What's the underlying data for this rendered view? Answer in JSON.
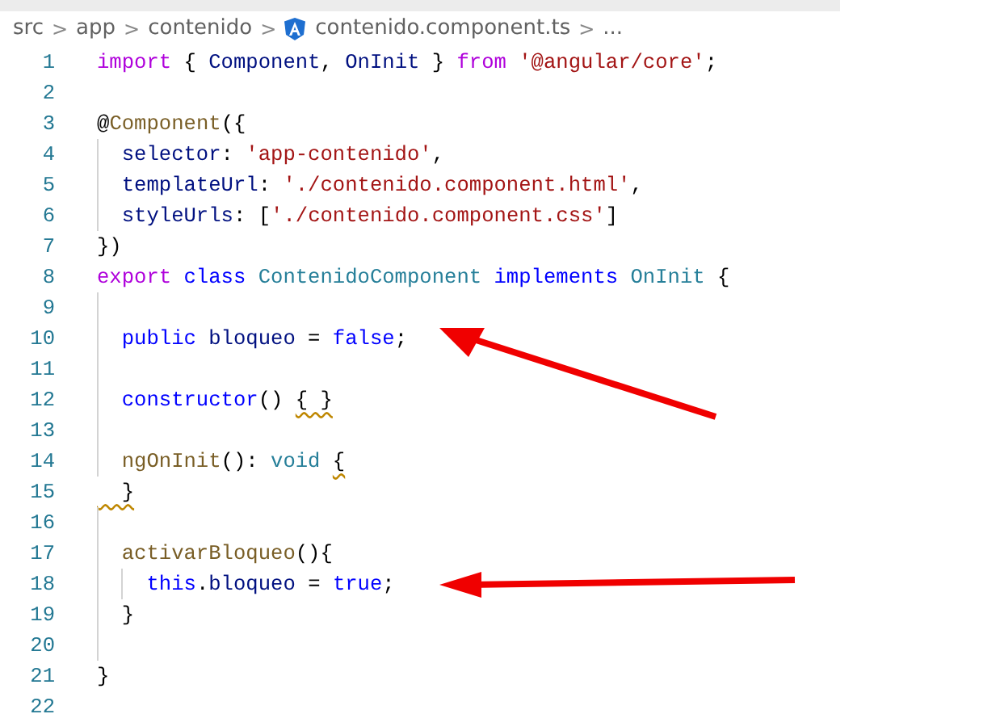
{
  "breadcrumb": [
    {
      "label": "src",
      "kind": "folder"
    },
    {
      "label": ">",
      "kind": "separator"
    },
    {
      "label": "app",
      "kind": "folder"
    },
    {
      "label": ">",
      "kind": "separator"
    },
    {
      "label": "contenido",
      "kind": "folder"
    },
    {
      "label": ">",
      "kind": "separator"
    },
    {
      "label": "contenido.component.ts",
      "kind": "file"
    },
    {
      "label": ">",
      "kind": "separator"
    },
    {
      "label": "...",
      "kind": "more"
    }
  ],
  "lines": [
    {
      "number": "1",
      "tokens": [
        {
          "t": "import",
          "kind": "kw"
        },
        {
          "t": " { ",
          "kind": "p"
        },
        {
          "t": "Component",
          "kind": "var"
        },
        {
          "t": ", ",
          "kind": "p"
        },
        {
          "t": "OnInit",
          "kind": "var"
        },
        {
          "t": " } ",
          "kind": "p"
        },
        {
          "t": "from",
          "kind": "kw"
        },
        {
          "t": " '@angular/core'",
          "kind": "str"
        },
        {
          "t": ";",
          "kind": "p"
        }
      ]
    },
    {
      "number": "2"
    },
    {
      "number": "3",
      "tokens": [
        {
          "t": "@",
          "kind": "p"
        },
        {
          "t": "Component",
          "kind": "fn"
        },
        {
          "t": "({",
          "kind": "p"
        }
      ]
    },
    {
      "number": "4",
      "indent_guide": true,
      "tokens": [
        {
          "t": "  selector",
          "kind": "var"
        },
        {
          "t": ": ",
          "kind": "p"
        },
        {
          "t": "'app-contenido'",
          "kind": "str"
        },
        {
          "t": ",",
          "kind": "p"
        }
      ]
    },
    {
      "number": "5",
      "indent_guide": true,
      "tokens": [
        {
          "t": "  templateUrl",
          "kind": "var"
        },
        {
          "t": ": ",
          "kind": "p"
        },
        {
          "t": "'./contenido.component.html'",
          "kind": "str"
        },
        {
          "t": ",",
          "kind": "p"
        }
      ]
    },
    {
      "number": "6",
      "indent_guide": true,
      "tokens": [
        {
          "t": "  styleUrls",
          "kind": "var"
        },
        {
          "t": ": [",
          "kind": "p"
        },
        {
          "t": "'./contenido.component.css'",
          "kind": "str"
        },
        {
          "t": "]",
          "kind": "p"
        }
      ]
    },
    {
      "number": "7",
      "tokens": [
        {
          "t": "})",
          "kind": "p"
        }
      ]
    },
    {
      "number": "8",
      "tokens": [
        {
          "t": "export",
          "kind": "kw"
        },
        {
          "t": " class",
          "kind": "st"
        },
        {
          "t": " ContenidoComponent",
          "kind": "type"
        },
        {
          "t": " implements",
          "kind": "st"
        },
        {
          "t": " OnInit",
          "kind": "type"
        },
        {
          "t": " {",
          "kind": "p"
        }
      ]
    },
    {
      "number": "9",
      "indent_guide": true
    },
    {
      "number": "10",
      "indent_guide": true,
      "arrow": true,
      "tokens": [
        {
          "t": "  public",
          "kind": "st"
        },
        {
          "t": " bloqueo",
          "kind": "var"
        },
        {
          "t": " = ",
          "kind": "p"
        },
        {
          "t": "false",
          "kind": "st"
        },
        {
          "t": ";",
          "kind": "p"
        }
      ]
    },
    {
      "number": "11",
      "indent_guide": true
    },
    {
      "number": "12",
      "indent_guide": true,
      "tokens": [
        {
          "t": "  constructor",
          "kind": "st"
        },
        {
          "t": "() ",
          "kind": "p"
        },
        {
          "t": "{ }",
          "kind": "p",
          "squiggle": true
        }
      ]
    },
    {
      "number": "13",
      "indent_guide": true
    },
    {
      "number": "14",
      "indent_guide": true,
      "tokens": [
        {
          "t": "  ngOnInit",
          "kind": "fn"
        },
        {
          "t": "(): ",
          "kind": "p"
        },
        {
          "t": "void ",
          "kind": "type"
        },
        {
          "t": "{",
          "kind": "p",
          "squiggle": true
        }
      ]
    },
    {
      "number": "15",
      "tokens": [
        {
          "t": "  }",
          "kind": "p",
          "squiggle": true
        }
      ]
    },
    {
      "number": "16",
      "indent_guide": true
    },
    {
      "number": "17",
      "indent_guide": true,
      "tokens": [
        {
          "t": "  activarBloqueo",
          "kind": "fn"
        },
        {
          "t": "(){",
          "kind": "p"
        }
      ]
    },
    {
      "number": "18",
      "indent_guide": true,
      "inner_guide": true,
      "arrow": true,
      "tokens": [
        {
          "t": "    this",
          "kind": "st"
        },
        {
          "t": ".",
          "kind": "p"
        },
        {
          "t": "bloqueo",
          "kind": "var"
        },
        {
          "t": " = ",
          "kind": "p"
        },
        {
          "t": "true",
          "kind": "st"
        },
        {
          "t": ";",
          "kind": "p"
        }
      ]
    },
    {
      "number": "19",
      "indent_guide": true,
      "tokens": [
        {
          "t": "  }",
          "kind": "p"
        }
      ]
    },
    {
      "number": "20",
      "indent_guide": true
    },
    {
      "number": "21",
      "tokens": [
        {
          "t": "}",
          "kind": "p"
        }
      ]
    },
    {
      "number": "22"
    }
  ]
}
